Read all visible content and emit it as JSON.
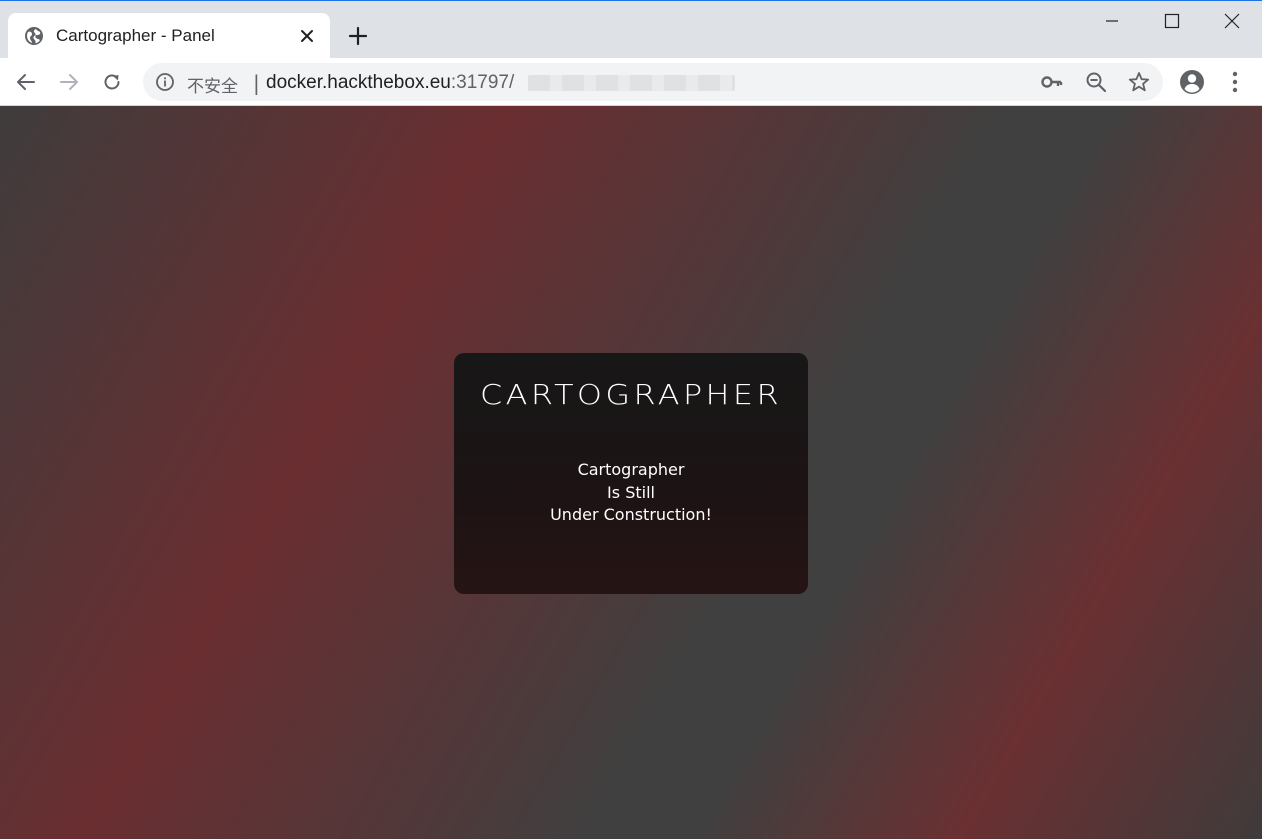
{
  "tab": {
    "title": "Cartographer - Panel",
    "favicon": "globe-icon"
  },
  "window_controls": [
    "minimize-icon",
    "maximize-icon",
    "close-icon"
  ],
  "toolbar": {
    "back_icon": "arrow-left-icon",
    "forward_icon": "arrow-right-icon",
    "reload_icon": "reload-icon"
  },
  "omnibox": {
    "security_label": "不安全",
    "separator": "|",
    "url_host": "docker.hackthebox.eu",
    "url_port": ":31797/",
    "icons": [
      "key-icon",
      "zoom-out-icon",
      "star-icon"
    ]
  },
  "page": {
    "logo_text": "CARTOGRAPHER",
    "message_lines": [
      "Cartographer",
      "Is Still",
      "Under Construction!"
    ]
  },
  "colors": {
    "tabstrip": "#dee1e6",
    "page_red": "#6a2e31",
    "page_gray": "#404040",
    "card_bg": "#171717",
    "text": "#ffffff"
  }
}
